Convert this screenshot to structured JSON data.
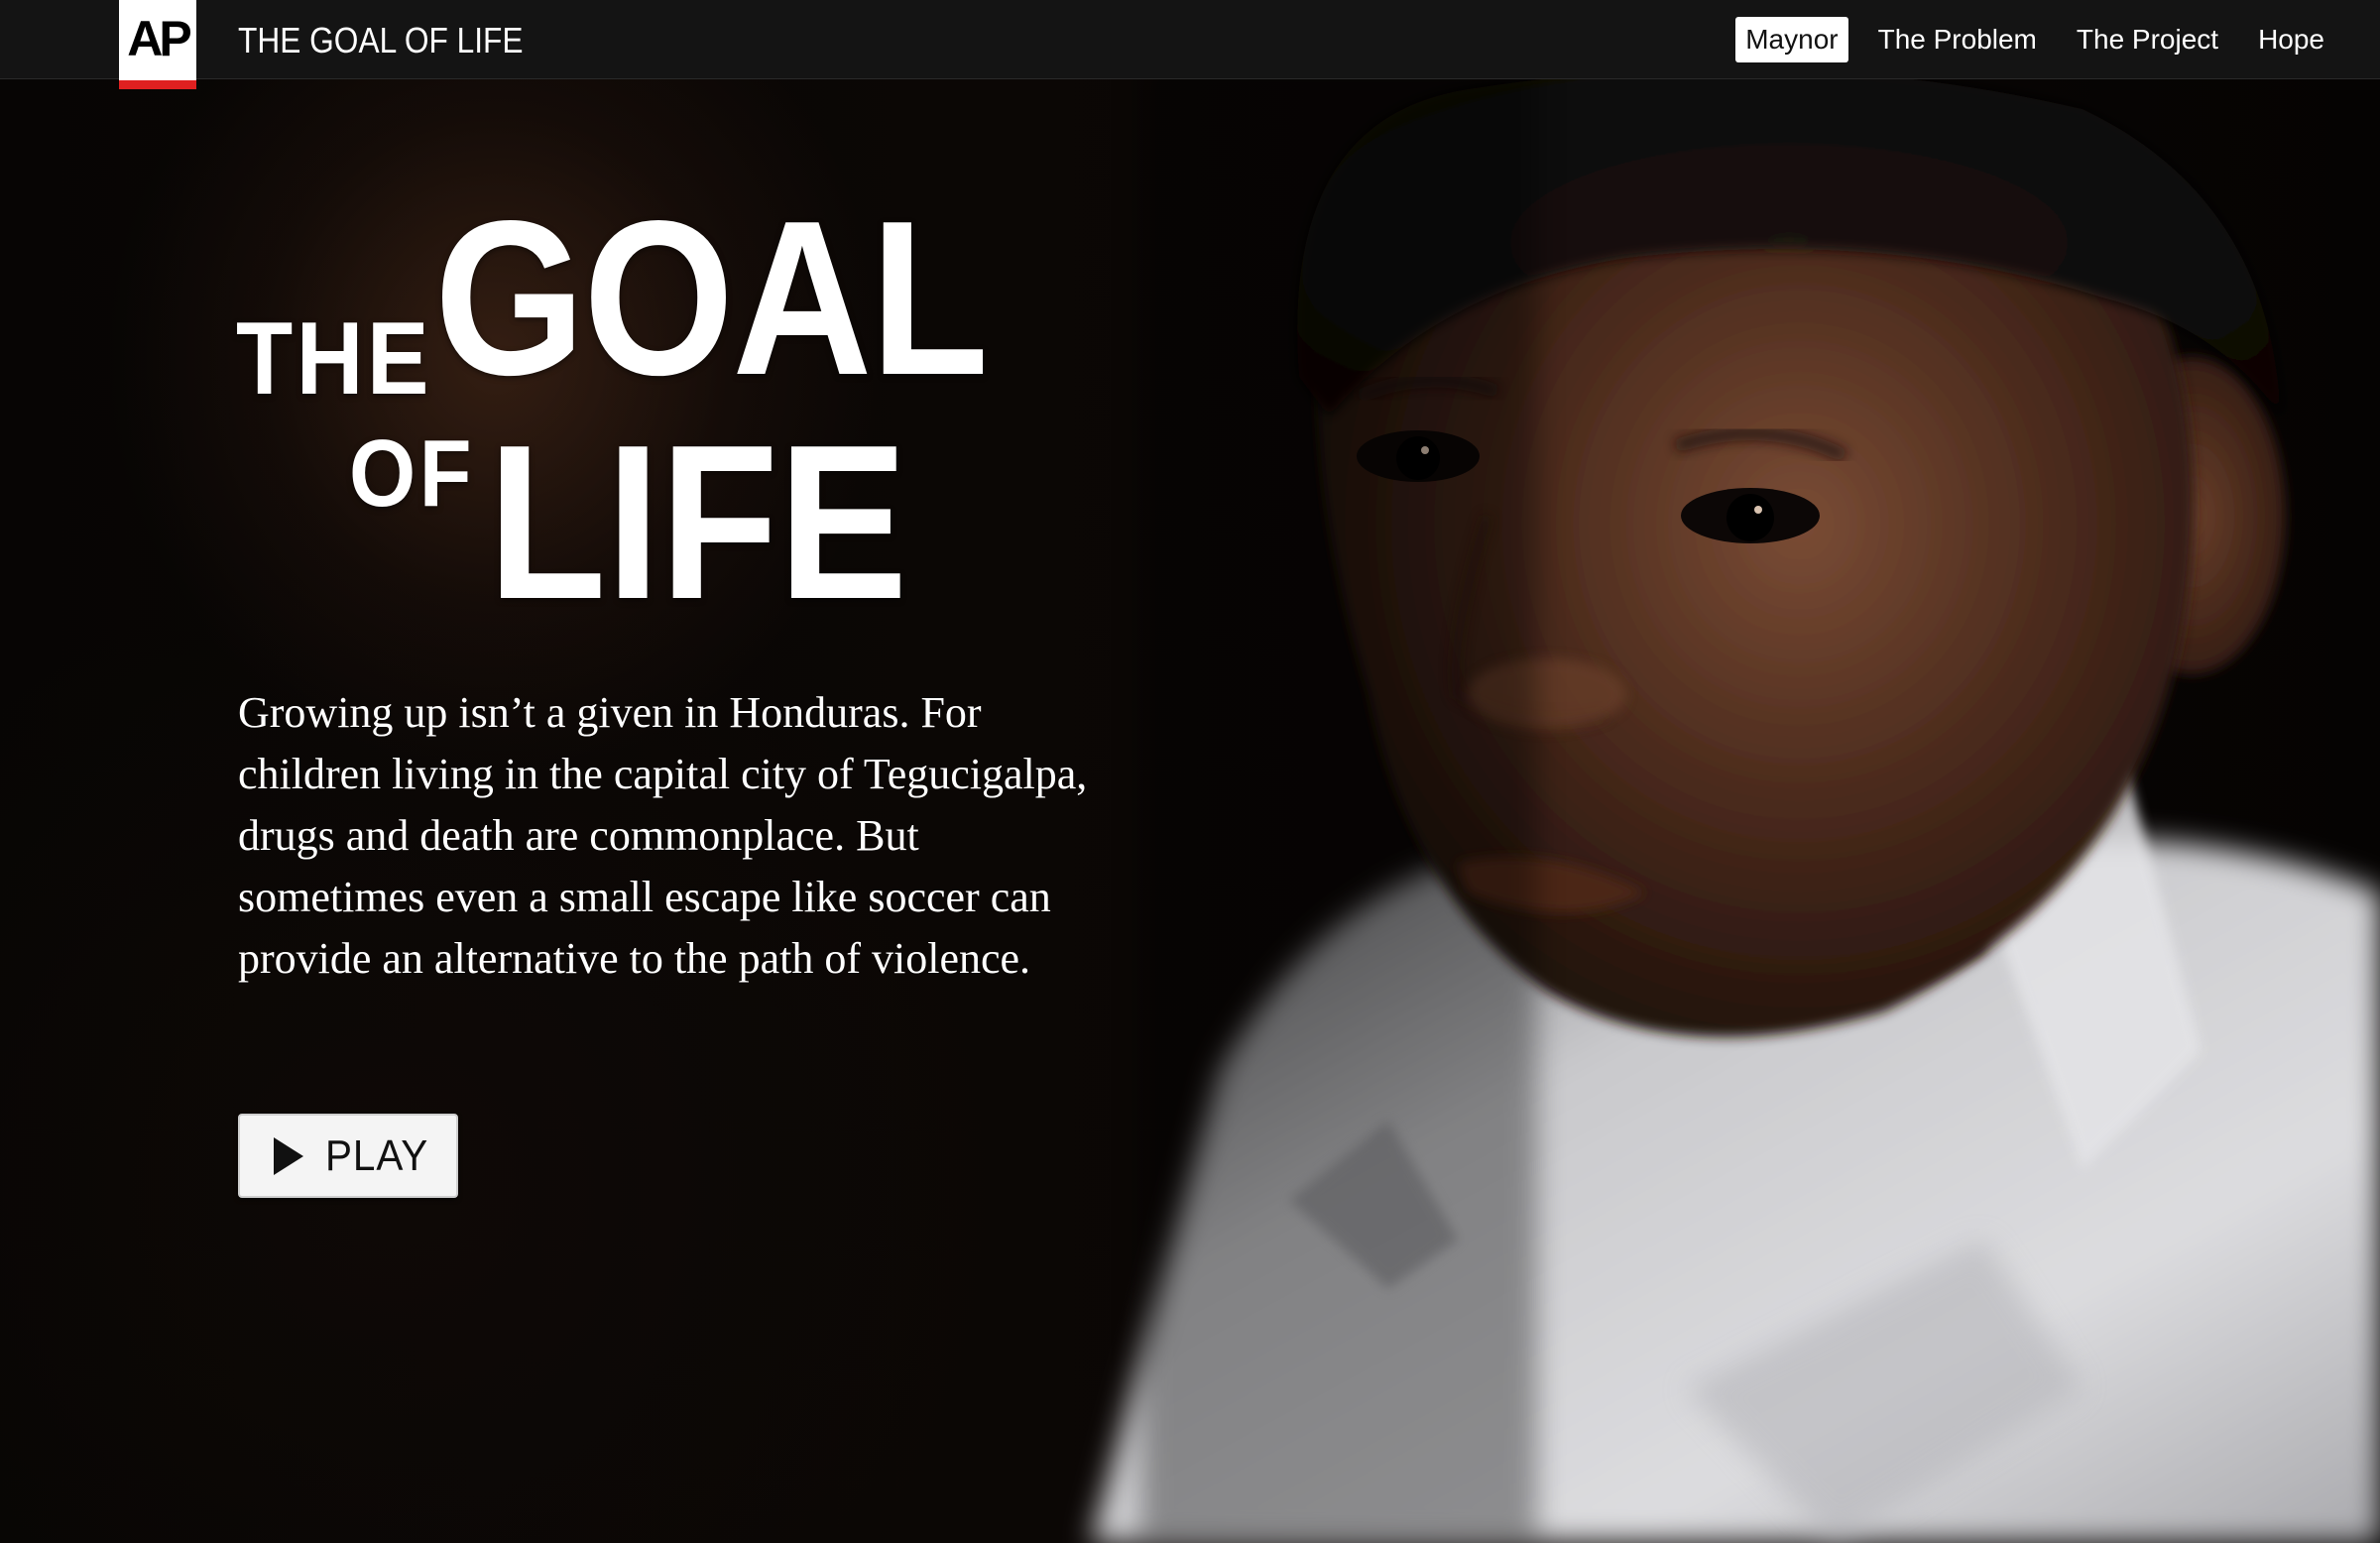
{
  "header": {
    "logo_text": "AP",
    "site_title": "THE GOAL OF LIFE",
    "nav": [
      {
        "label": "Maynor",
        "active": true
      },
      {
        "label": "The Problem",
        "active": false
      },
      {
        "label": "The Project",
        "active": false
      },
      {
        "label": "Hope",
        "active": false
      }
    ]
  },
  "hero": {
    "headline": {
      "the": "THE",
      "goal": "GOAL",
      "of": "OF",
      "life": "LIFE"
    },
    "intro": "Growing up isn’t a given in Honduras. For children living in the capital city of Tegucigalpa, drugs and death are commonplace. But sometimes even a small escape like soccer can provide an alternative to the path of violence.",
    "play_label": "PLAY",
    "play_icon": "play-icon"
  },
  "colors": {
    "topbar": "#141414",
    "logo_red": "#e02020",
    "active_nav_bg": "#ffffff",
    "text": "#ffffff"
  }
}
